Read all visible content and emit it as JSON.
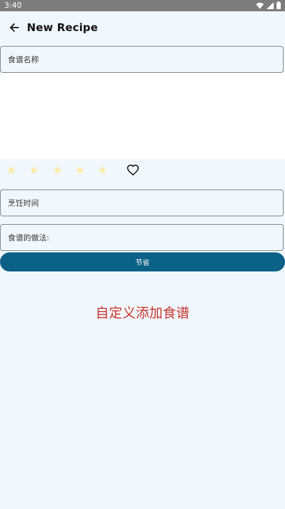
{
  "status_bar": {
    "time": "3:40"
  },
  "app_bar": {
    "title": "New Recipe"
  },
  "form": {
    "name_placeholder": "食谱名称",
    "cook_time_placeholder": "烹饪时间",
    "method_placeholder": "食谱的做法:",
    "save_label": "节省"
  },
  "rating": {
    "value": 0,
    "max": 5,
    "star_color": "#fbe9a3"
  },
  "favorite": {
    "active": false
  },
  "banner": {
    "text": "自定义添加食谱",
    "color": "#c9342e"
  },
  "colors": {
    "primary": "#0c6186",
    "background": "#f1f8fd",
    "status_bar": "#7c7c7c"
  }
}
